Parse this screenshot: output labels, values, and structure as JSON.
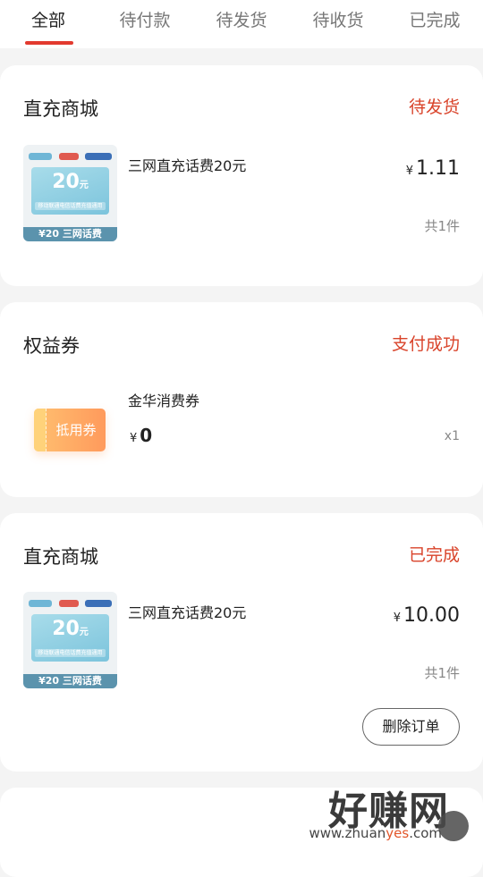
{
  "tabs": [
    {
      "label": "全部",
      "active": true
    },
    {
      "label": "待付款",
      "active": false
    },
    {
      "label": "待发货",
      "active": false
    },
    {
      "label": "待收货",
      "active": false
    },
    {
      "label": "已完成",
      "active": false
    }
  ],
  "orders": [
    {
      "shop": "直充商城",
      "status": "待发货",
      "product": {
        "name": "三网直充话费20元",
        "thumb_amount": "20",
        "thumb_unit": "元",
        "thumb_caption": "移动联通电信话费充值通用",
        "thumb_bar": "¥20 三网话费"
      },
      "currency": "¥",
      "price": "1.11",
      "quantity": "共1件"
    },
    {
      "shop": "权益券",
      "status": "支付成功",
      "product": {
        "name": "金华消费券",
        "coupon_label": "抵用券"
      },
      "currency": "¥",
      "price": "0",
      "quantity": "x1"
    },
    {
      "shop": "直充商城",
      "status": "已完成",
      "product": {
        "name": "三网直充话费20元",
        "thumb_amount": "20",
        "thumb_unit": "元",
        "thumb_caption": "移动联通电信话费充值通用",
        "thumb_bar": "¥20 三网话费"
      },
      "currency": "¥",
      "price": "10.00",
      "quantity": "共1件",
      "action_label": "删除订单"
    }
  ],
  "watermark": {
    "main": "好赚网",
    "url_prefix": "www.zhuan",
    "url_highlight": "yes",
    "url_suffix": ".com"
  },
  "colors": {
    "accent": "#e23a2f",
    "status": "#d9432a",
    "background": "#f4f4f4"
  },
  "icons": [
    "china-mobile-logo-icon",
    "china-unicom-logo-icon",
    "china-telecom-logo-icon",
    "coupon-icon"
  ]
}
